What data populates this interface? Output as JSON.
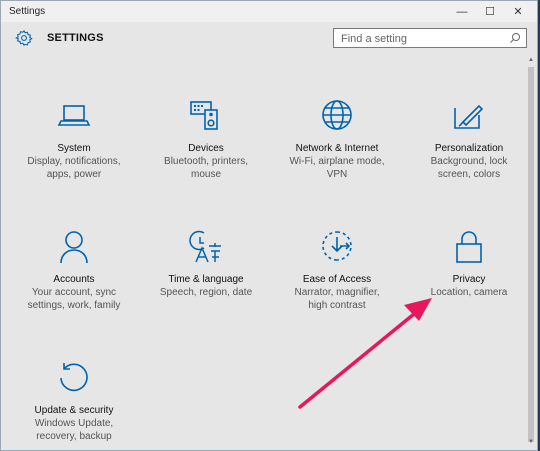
{
  "window": {
    "title": "Settings",
    "minimize": "—",
    "maximize": "☐",
    "close": "✕"
  },
  "header": {
    "title": "SETTINGS",
    "gear_icon": "gear-icon"
  },
  "search": {
    "placeholder": "Find a setting",
    "icon": "search-icon"
  },
  "tiles": [
    {
      "name": "System",
      "desc": [
        "Display, notifications,",
        "apps, power"
      ],
      "icon": "laptop-icon"
    },
    {
      "name": "Devices",
      "desc": [
        "Bluetooth, printers,",
        "mouse"
      ],
      "icon": "devices-icon"
    },
    {
      "name": "Network & Internet",
      "desc": [
        "Wi-Fi, airplane mode,",
        "VPN"
      ],
      "icon": "globe-icon"
    },
    {
      "name": "Personalization",
      "desc": [
        "Background, lock",
        "screen, colors"
      ],
      "icon": "paint-icon"
    },
    {
      "name": "Accounts",
      "desc": [
        "Your account, sync",
        "settings, work, family"
      ],
      "icon": "person-icon"
    },
    {
      "name": "Time & language",
      "desc": [
        "Speech, region, date"
      ],
      "icon": "time-language-icon"
    },
    {
      "name": "Ease of Access",
      "desc": [
        "Narrator, magnifier,",
        "high contrast"
      ],
      "icon": "ease-of-access-icon"
    },
    {
      "name": "Privacy",
      "desc": [
        "Location, camera"
      ],
      "icon": "lock-icon"
    },
    {
      "name": "Update & security",
      "desc": [
        "Windows Update,",
        "recovery, backup"
      ],
      "icon": "refresh-icon"
    }
  ],
  "colors": {
    "accent": "#0063b1",
    "arrow": "#e8175d"
  }
}
